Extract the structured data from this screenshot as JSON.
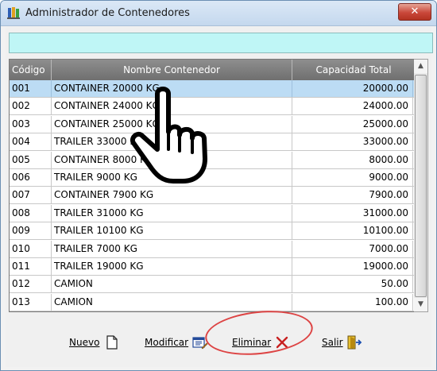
{
  "window": {
    "title": "Administrador de Contenedores",
    "close_label": "✕"
  },
  "search": {
    "value": ""
  },
  "table": {
    "columns": [
      "Código",
      "Nombre Contenedor",
      "Capacidad Total"
    ],
    "rows": [
      {
        "code": "001",
        "name": "CONTAINER 20000 KG",
        "capacity": "20000.00",
        "selected": true
      },
      {
        "code": "002",
        "name": "CONTAINER 24000 KG",
        "capacity": "24000.00"
      },
      {
        "code": "003",
        "name": "CONTAINER 25000 KG",
        "capacity": "25000.00"
      },
      {
        "code": "004",
        "name": "TRAILER 33000 KG",
        "capacity": "33000.00"
      },
      {
        "code": "005",
        "name": "CONTAINER 8000 KG",
        "capacity": "8000.00"
      },
      {
        "code": "006",
        "name": "TRAILER 9000 KG",
        "capacity": "9000.00"
      },
      {
        "code": "007",
        "name": "CONTAINER 7900 KG",
        "capacity": "7900.00"
      },
      {
        "code": "008",
        "name": "TRAILER 31000 KG",
        "capacity": "31000.00"
      },
      {
        "code": "009",
        "name": "TRAILER 10100 KG",
        "capacity": "10100.00"
      },
      {
        "code": "010",
        "name": "TRAILER 7000 KG",
        "capacity": "7000.00"
      },
      {
        "code": "011",
        "name": "TRAILER 19000 KG",
        "capacity": "19000.00"
      },
      {
        "code": "012",
        "name": "CAMION",
        "capacity": "50.00"
      },
      {
        "code": "013",
        "name": "CAMION",
        "capacity": "100.00"
      }
    ]
  },
  "buttons": {
    "new": {
      "label": "Nuevo",
      "icon": "document-icon"
    },
    "modify": {
      "label": "Modificar",
      "icon": "edit-icon"
    },
    "delete": {
      "label": "Eliminar",
      "icon": "delete-x-icon"
    },
    "exit": {
      "label": "Salir",
      "icon": "exit-door-icon"
    }
  },
  "cursor": {
    "icon": "hand-pointer-icon"
  },
  "highlight": {
    "color": "#dd4444"
  }
}
